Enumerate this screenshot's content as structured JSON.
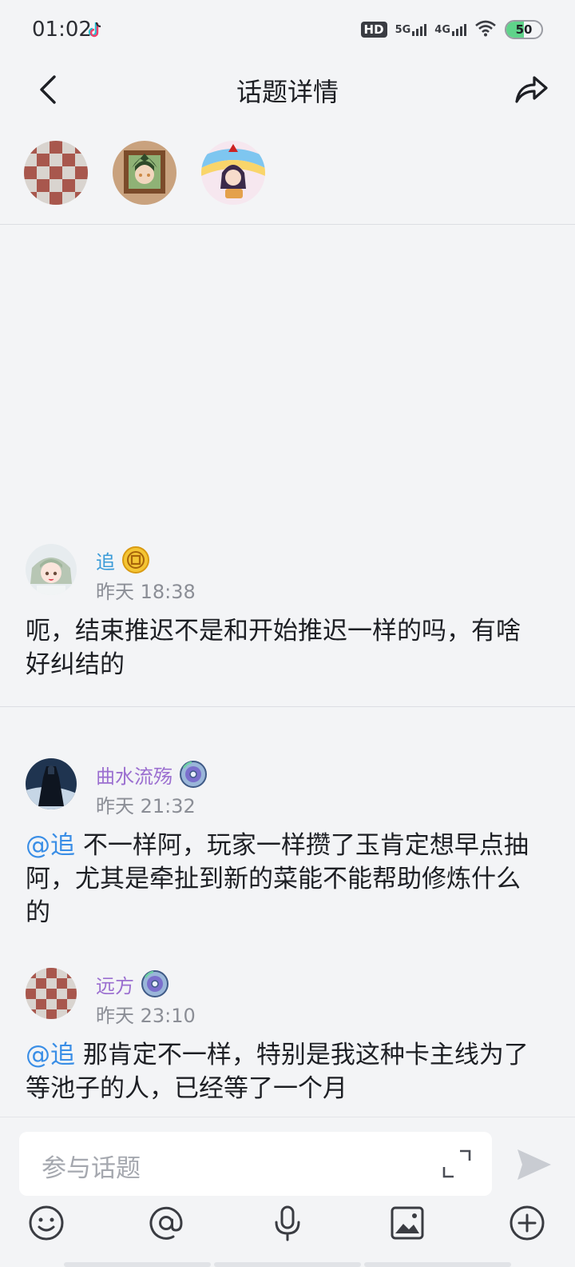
{
  "status_bar": {
    "time": "01:02",
    "hd_label": "HD",
    "net1": "5G",
    "net2": "4G",
    "battery": "50",
    "battery_level": 0.5
  },
  "header": {
    "title": "话题详情",
    "back_icon": "back-arrow-icon",
    "share_icon": "share-icon"
  },
  "posts": [
    {
      "name": "追",
      "name_color": "#3a9bd8",
      "badge": "gold-coin-badge",
      "time": "昨天 18:38",
      "body": "呃，结束推迟不是和开始推迟一样的吗，有啥好纠结的"
    },
    {
      "name": "曲水流殇",
      "name_color": "#9b6fd0",
      "badge": "disc-badge",
      "time": "昨天 21:32",
      "mention": "@追",
      "body": " 不一样阿，玩家一样攒了玉肯定想早点抽阿，尤其是牵扯到新的菜能不能帮助修炼什么的"
    },
    {
      "name": "远方",
      "name_color": "#9b6fd0",
      "badge": "disc-badge",
      "time": "昨天 23:10",
      "mention": "@追",
      "body": " 那肯定不一样，特别是我这种卡主线为了等池子的人，已经等了一个月"
    }
  ],
  "input": {
    "placeholder": "参与话题"
  },
  "toolbar": [
    "emoji-icon",
    "at-icon",
    "microphone-icon",
    "image-icon",
    "plus-circle-icon"
  ]
}
